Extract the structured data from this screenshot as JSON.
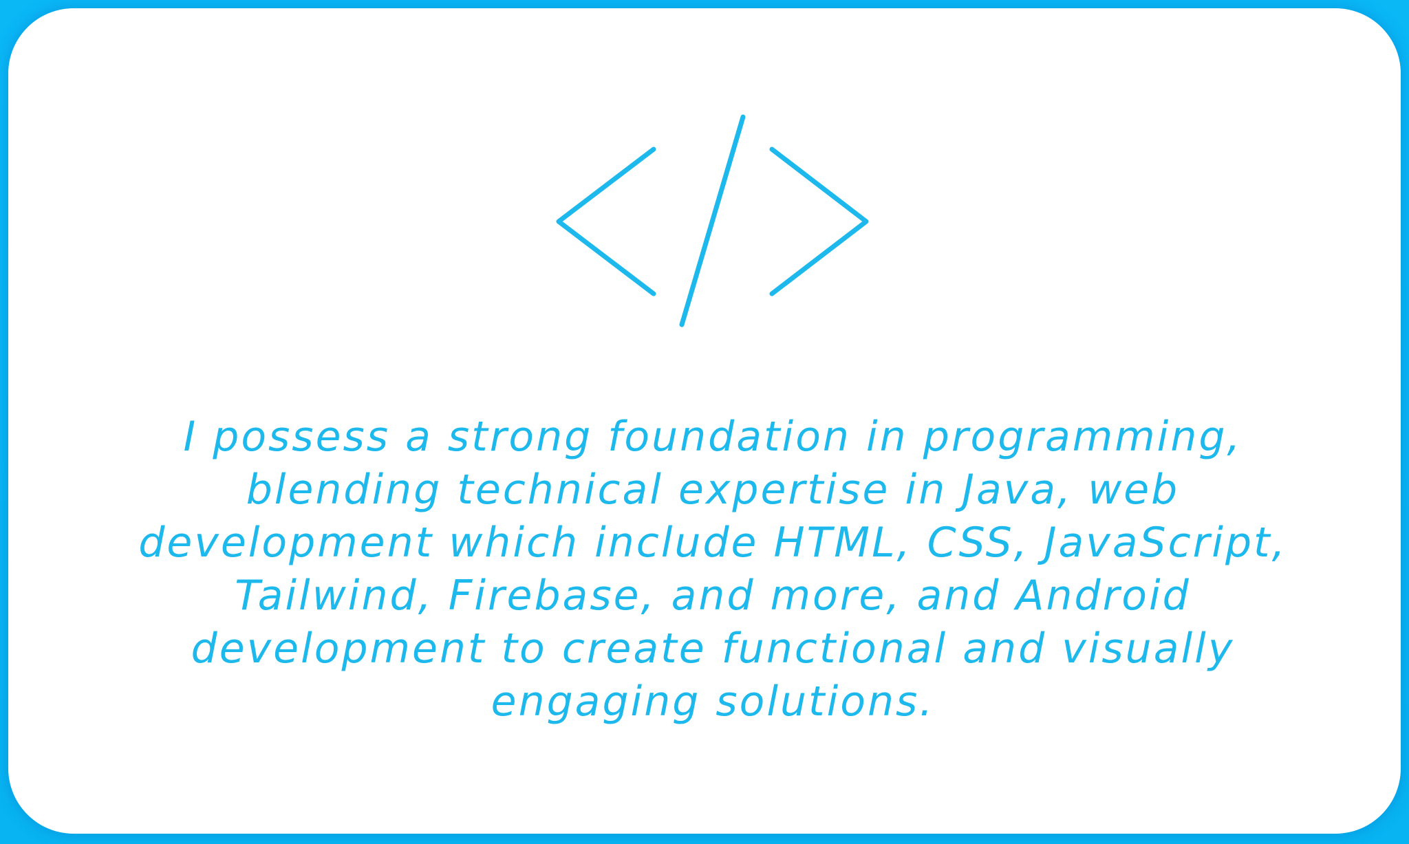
{
  "card": {
    "icon": "code-brackets-icon",
    "accent_color": "#1db9ec",
    "border_color": "#08b6f4",
    "description": "I possess a strong foundation in programming, blending technical expertise in Java, web development which include HTML, CSS, JavaScript, Tailwind, Firebase, and more, and Android development to create functional and visually engaging solutions."
  }
}
